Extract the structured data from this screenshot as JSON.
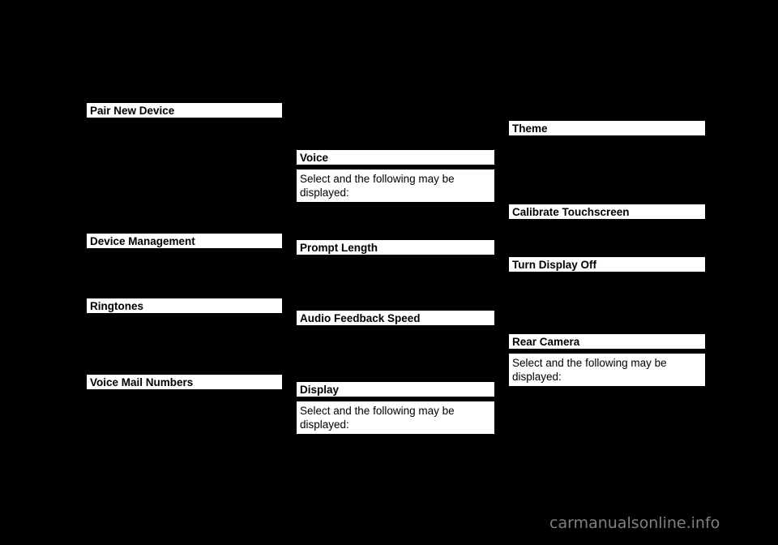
{
  "page": {
    "background_color": "#000000",
    "highlight_color": "#ffffff",
    "highlight_text_color": "#000000"
  },
  "columns": {
    "left": {
      "items": [
        {
          "label": "Pair New Device"
        },
        {
          "label": "Device Management"
        },
        {
          "label": "Ringtones"
        },
        {
          "label": "Voice Mail Numbers"
        }
      ]
    },
    "middle": {
      "items": [
        {
          "label": "Voice",
          "body": "Select and the following may be displayed:"
        },
        {
          "label": "Prompt Length"
        },
        {
          "label": "Audio Feedback Speed"
        },
        {
          "label": "Display",
          "body": "Select and the following may be displayed:"
        }
      ]
    },
    "right": {
      "items": [
        {
          "label": "Theme"
        },
        {
          "label": "Calibrate Touchscreen"
        },
        {
          "label": "Turn Display Off"
        },
        {
          "label": "Rear Camera",
          "body": "Select and the following may be displayed:"
        }
      ]
    }
  },
  "watermark": {
    "text": "carmanualsonline.info",
    "color": "#808080"
  }
}
